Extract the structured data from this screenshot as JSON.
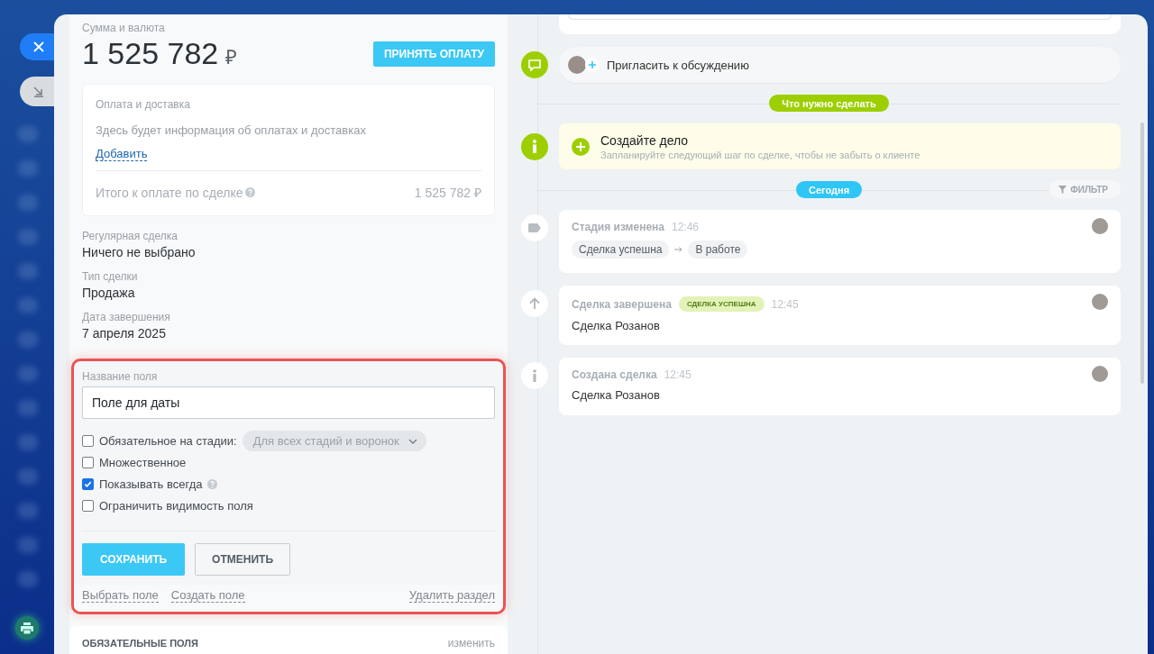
{
  "deal": {
    "amount_label": "Сумма и валюта",
    "amount": "1 525 782",
    "currency": "₽",
    "accept_button": "ПРИНЯТЬ ОПЛАТУ",
    "payment": {
      "title": "Оплата и доставка",
      "text": "Здесь будет информация об оплатах и доставках",
      "add_link": "Добавить",
      "total_label": "Итого к оплате по сделке",
      "total": "1 525 782 ₽"
    },
    "fields": [
      {
        "label": "Регулярная сделка",
        "value": "Ничего не выбрано"
      },
      {
        "label": "Тип сделки",
        "value": "Продажа"
      },
      {
        "label": "Дата завершения",
        "value": "7 апреля 2025"
      }
    ],
    "editor": {
      "name_label": "Название поля",
      "name_value": "Поле для даты",
      "options": [
        {
          "kind": "select",
          "label": "Обязательное на стадии:",
          "select": "Для всех стадий и воронок",
          "checked": false
        },
        {
          "kind": "plain",
          "label": "Множественное",
          "checked": false
        },
        {
          "kind": "help",
          "label": "Показывать всегда",
          "checked": true
        },
        {
          "kind": "plain",
          "label": "Ограничить видимость поля",
          "checked": false
        }
      ],
      "save": "СОХРАНИТЬ",
      "cancel": "ОТМЕНИТЬ",
      "links": [
        "Выбрать поле",
        "Создать поле"
      ],
      "delete": "Удалить раздел"
    },
    "required": {
      "title": "ОБЯЗАТЕЛЬНЫЕ ПОЛЯ",
      "change": "изменить"
    }
  },
  "timeline": {
    "invite": "Пригласить к обсуждению",
    "todo_badge": "Что нужно сделать",
    "task": {
      "title": "Создайте дело",
      "hint": "Запланируйте следующий шаг по сделке, чтобы не забыть о клиенте"
    },
    "today_badge": "Сегодня",
    "filter": "ФИЛЬТР",
    "events": [
      {
        "kind": "stage",
        "title": "Стадия изменена",
        "time": "12:46",
        "from": "Сделка успешна",
        "to": "В работе"
      },
      {
        "kind": "done",
        "title": "Сделка завершена",
        "tag": "СДЕЛКА УСПЕШНА",
        "time": "12:45",
        "text": "Сделка Розанов"
      },
      {
        "kind": "created",
        "title": "Создана сделка",
        "time": "12:45",
        "text": "Сделка Розанов"
      }
    ]
  }
}
